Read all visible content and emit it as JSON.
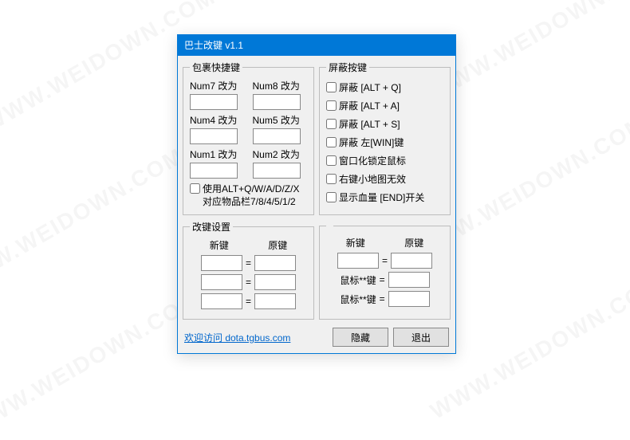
{
  "watermark": "WWW.WEIDOWN.COM",
  "window": {
    "title": "巴士改键 v1.1"
  },
  "package": {
    "legend": "包裹快捷键",
    "cells": [
      {
        "label": "Num7 改为",
        "value": ""
      },
      {
        "label": "Num8 改为",
        "value": ""
      },
      {
        "label": "Num4 改为",
        "value": ""
      },
      {
        "label": "Num5 改为",
        "value": ""
      },
      {
        "label": "Num1 改为",
        "value": ""
      },
      {
        "label": "Num2 改为",
        "value": ""
      }
    ],
    "alt_option": "使用ALT+Q/W/A/D/Z/X\n对应物品栏7/8/4/5/1/2"
  },
  "shield": {
    "legend": "屏蔽按键",
    "items": [
      "屏蔽 [ALT + Q]",
      "屏蔽 [ALT + A]",
      "屏蔽 [ALT + S]",
      "屏蔽 左[WIN]键",
      "窗口化锁定鼠标",
      "右键小地图无效",
      "显示血量 [END]开关"
    ]
  },
  "remap": {
    "legend": "改键设置",
    "head_new": "新键",
    "head_old": "原键",
    "left": [
      {
        "new": "",
        "old": "",
        "label_new": "",
        "label_old": ""
      },
      {
        "new": "",
        "old": "",
        "label_new": "",
        "label_old": ""
      },
      {
        "new": "",
        "old": "",
        "label_new": "",
        "label_old": ""
      }
    ],
    "right": [
      {
        "new": "",
        "old": "",
        "label_new": "",
        "label_old": ""
      },
      {
        "new": "",
        "old": "",
        "label_new": "鼠标**键",
        "label_old": ""
      },
      {
        "new": "",
        "old": "",
        "label_new": "鼠标**键",
        "label_old": ""
      }
    ]
  },
  "footer": {
    "link_text": "欢迎访问 dota.tgbus.com",
    "hide": "隐藏",
    "exit": "退出"
  }
}
